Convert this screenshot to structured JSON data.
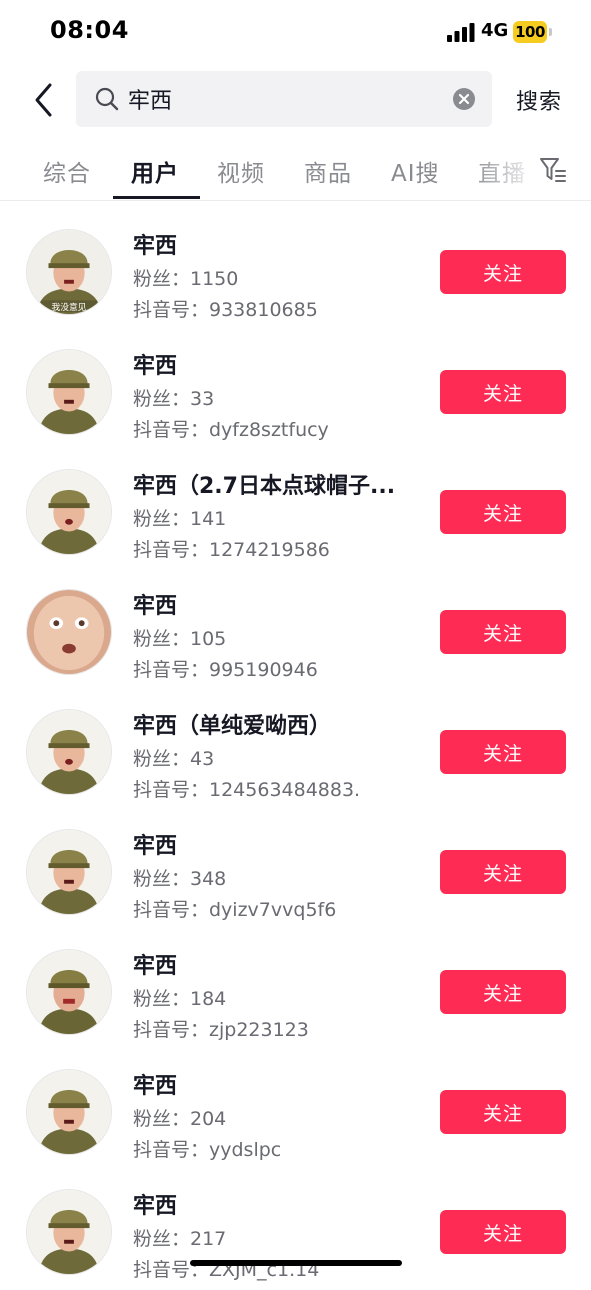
{
  "status_bar": {
    "time": "08:04",
    "network": "4G",
    "battery": "100",
    "battery_color": "#f5cc1f"
  },
  "search": {
    "query": "牢西",
    "submit_label": "搜索",
    "back_icon": "chevron-left-icon",
    "search_icon": "magnifier-icon",
    "clear_icon": "close-circle-icon"
  },
  "tabs": [
    {
      "label": "综合",
      "active": false
    },
    {
      "label": "用户",
      "active": true
    },
    {
      "label": "视频",
      "active": false
    },
    {
      "label": "商品",
      "active": false
    },
    {
      "label": "AI搜",
      "active": false
    },
    {
      "label": "直播",
      "active": false
    }
  ],
  "filter_icon": "filter-icon",
  "accent_color": "#fe2c55",
  "users": [
    {
      "name": "牢西",
      "fans": "粉丝：1150",
      "douyin_id": "抖音号：933810685",
      "follow_label": "关注",
      "avatar_caption": "我没意见"
    },
    {
      "name": "牢西",
      "fans": "粉丝：33",
      "douyin_id": "抖音号：dyfz8sztfucy",
      "follow_label": "关注"
    },
    {
      "name": "牢西（2.7日本点球帽子...",
      "fans": "粉丝：141",
      "douyin_id": "抖音号：1274219586",
      "follow_label": "关注"
    },
    {
      "name": "牢西",
      "fans": "粉丝：105",
      "douyin_id": "抖音号：995190946",
      "follow_label": "关注"
    },
    {
      "name": "牢西（单纯爱呦西）",
      "fans": "粉丝：43",
      "douyin_id": "抖音号：124563484883.",
      "follow_label": "关注"
    },
    {
      "name": "牢西",
      "fans": "粉丝：348",
      "douyin_id": "抖音号：dyizv7vvq5f6",
      "follow_label": "关注"
    },
    {
      "name": "牢西",
      "fans": "粉丝：184",
      "douyin_id": "抖音号：zjp223123",
      "follow_label": "关注"
    },
    {
      "name": "牢西",
      "fans": "粉丝：204",
      "douyin_id": "抖音号：yydslpc",
      "follow_label": "关注"
    },
    {
      "name": "牢西",
      "fans": "粉丝：217",
      "douyin_id": "抖音号：ZXJM_c1.14",
      "follow_label": "关注"
    }
  ]
}
